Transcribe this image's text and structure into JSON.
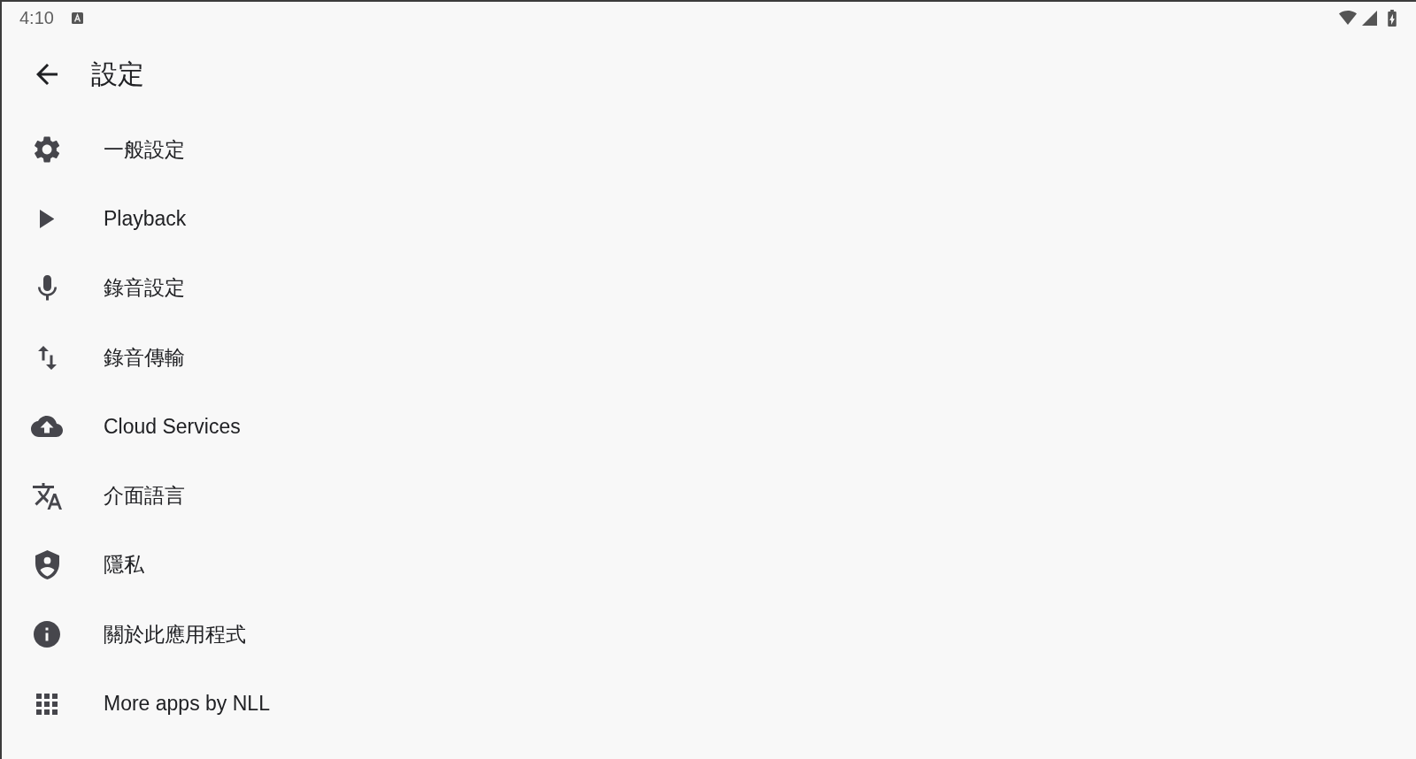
{
  "status_bar": {
    "time": "4:10"
  },
  "app_bar": {
    "title": "設定"
  },
  "settings": [
    {
      "label": "一般設定"
    },
    {
      "label": "Playback"
    },
    {
      "label": "錄音設定"
    },
    {
      "label": "錄音傳輸"
    },
    {
      "label": "Cloud Services"
    },
    {
      "label": "介面語言"
    },
    {
      "label": "隱私"
    },
    {
      "label": "關於此應用程式"
    },
    {
      "label": "More apps by NLL"
    }
  ]
}
